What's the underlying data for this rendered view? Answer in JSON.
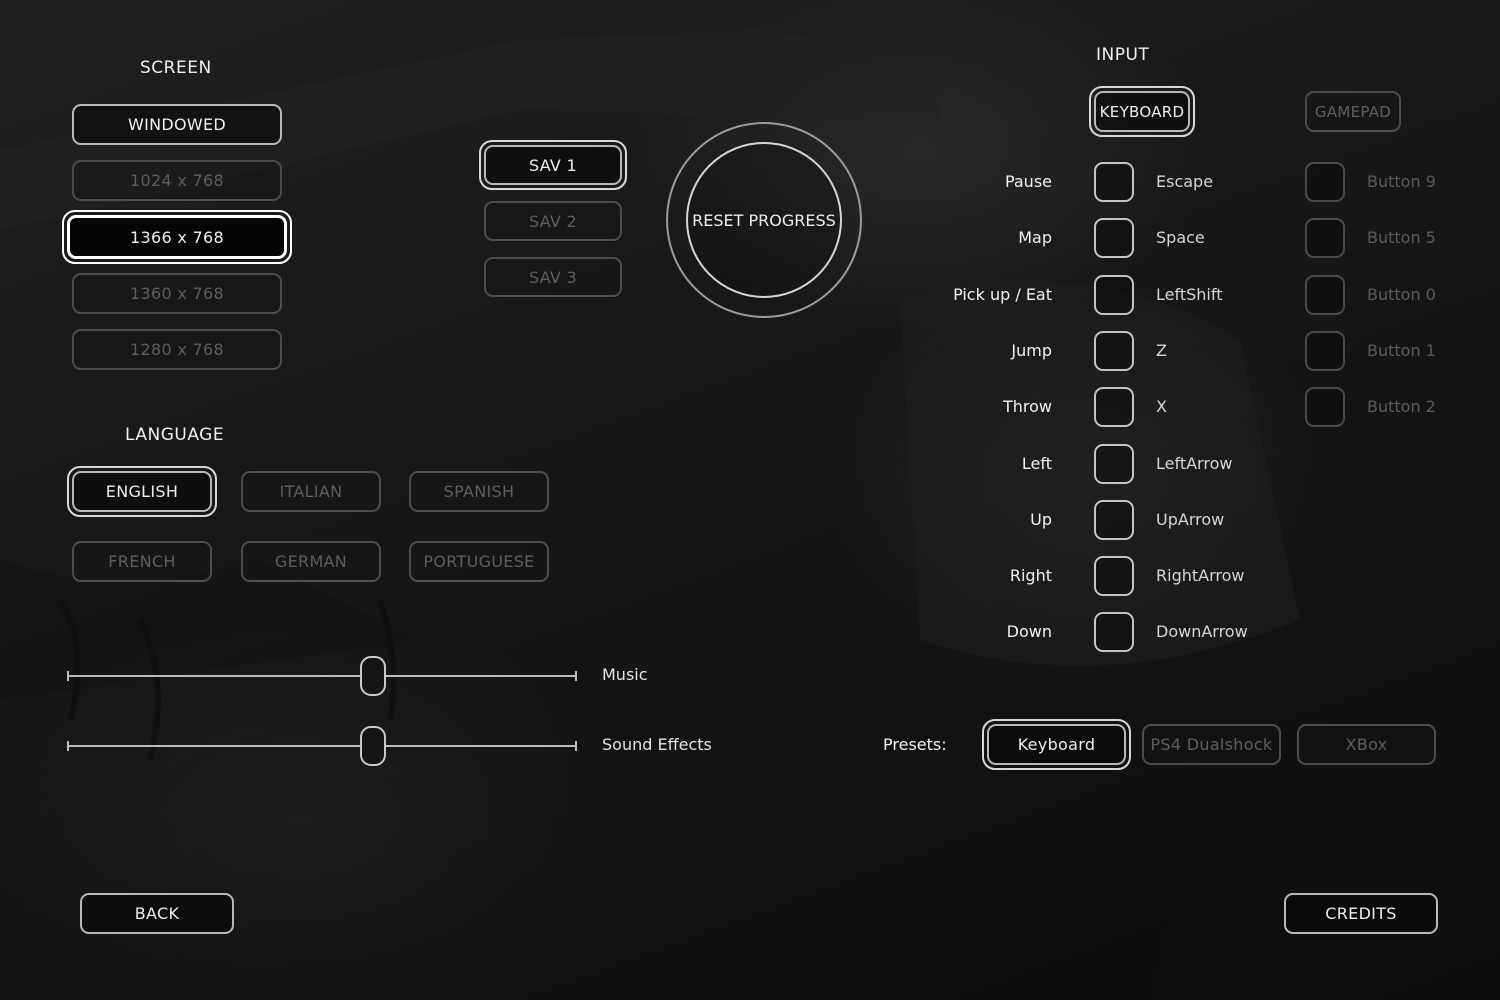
{
  "screen": {
    "heading": "SCREEN",
    "options": [
      "WINDOWED",
      "1024 x 768",
      "1366 x 768",
      "1360 x 768",
      "1280 x 768"
    ]
  },
  "saves": {
    "slots": [
      "SAV 1",
      "SAV 2",
      "SAV 3"
    ]
  },
  "reset": {
    "label": "RESET PROGRESS"
  },
  "language": {
    "heading": "LANGUAGE",
    "options": [
      "ENGLISH",
      "ITALIAN",
      "SPANISH",
      "FRENCH",
      "GERMAN",
      "PORTUGUESE"
    ]
  },
  "audio": {
    "music_label": "Music",
    "music_level": 0.6,
    "sfx_label": "Sound Effects",
    "sfx_level": 0.6
  },
  "input": {
    "heading": "INPUT",
    "keyboard_tab": "KEYBOARD",
    "gamepad_tab": "GAMEPAD",
    "bindings": [
      {
        "action": "Pause",
        "key": "Escape",
        "pad": "Button 9"
      },
      {
        "action": "Map",
        "key": "Space",
        "pad": "Button 5"
      },
      {
        "action": "Pick up / Eat",
        "key": "LeftShift",
        "pad": "Button 0"
      },
      {
        "action": "Jump",
        "key": "Z",
        "pad": "Button 1"
      },
      {
        "action": "Throw",
        "key": "X",
        "pad": "Button 2"
      },
      {
        "action": "Left",
        "key": "LeftArrow"
      },
      {
        "action": "Up",
        "key": "UpArrow"
      },
      {
        "action": "Right",
        "key": "RightArrow"
      },
      {
        "action": "Down",
        "key": "DownArrow"
      }
    ]
  },
  "presets": {
    "label": "Presets:",
    "options": [
      "Keyboard",
      "PS4 Dualshock",
      "XBox"
    ]
  },
  "footer": {
    "back": "BACK",
    "credits": "CREDITS"
  }
}
